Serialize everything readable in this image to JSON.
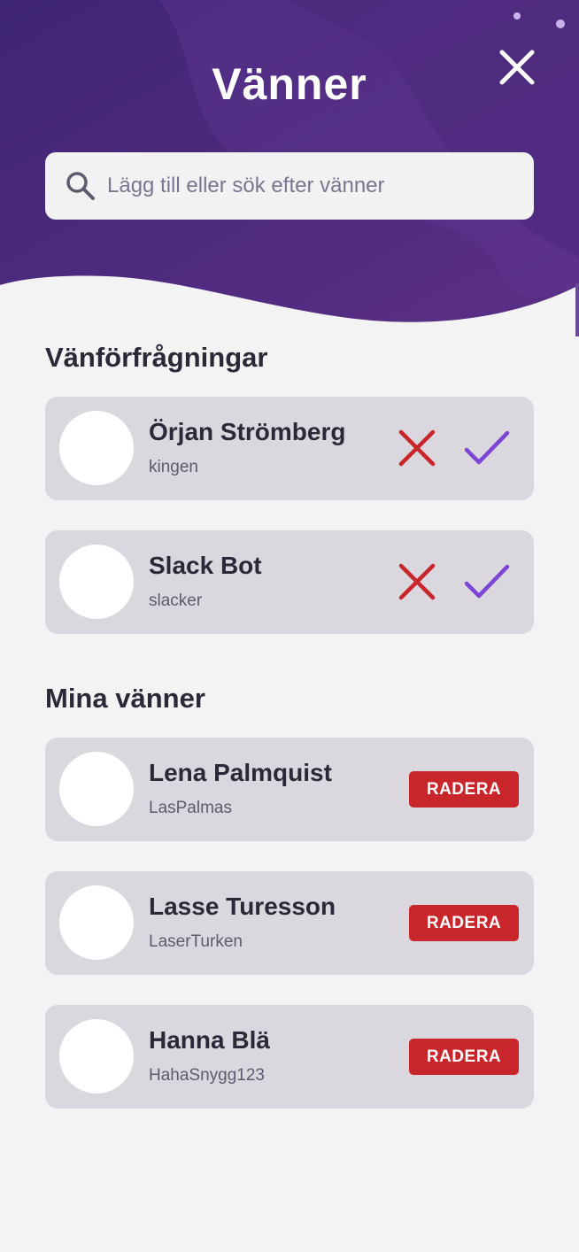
{
  "header": {
    "title": "Vänner",
    "close_icon": "close-icon",
    "colors": {
      "gradient_start": "#3f2576",
      "gradient_end": "#5b2f86",
      "wave_overlay": "#6a3f95"
    }
  },
  "search": {
    "placeholder": "Lägg till eller sök efter vänner",
    "value": "",
    "icon": "search-icon"
  },
  "requests": {
    "title": "Vänförfrågningar",
    "items": [
      {
        "name": "Örjan Strömberg",
        "username": "kingen",
        "reject_icon": "x-icon",
        "accept_icon": "check-icon"
      },
      {
        "name": "Slack Bot",
        "username": "slacker",
        "reject_icon": "x-icon",
        "accept_icon": "check-icon"
      }
    ],
    "colors": {
      "reject": "#c8262b",
      "accept": "#7d45d6"
    }
  },
  "friends": {
    "title": "Mina vänner",
    "delete_label": "RADERA",
    "items": [
      {
        "name": "Lena Palmquist",
        "username": "LasPalmas"
      },
      {
        "name": "Lasse Turesson",
        "username": "LaserTurken"
      },
      {
        "name": "Hanna Blä",
        "username": "HahaSnygg123"
      }
    ],
    "colors": {
      "delete": "#c8262b"
    }
  }
}
